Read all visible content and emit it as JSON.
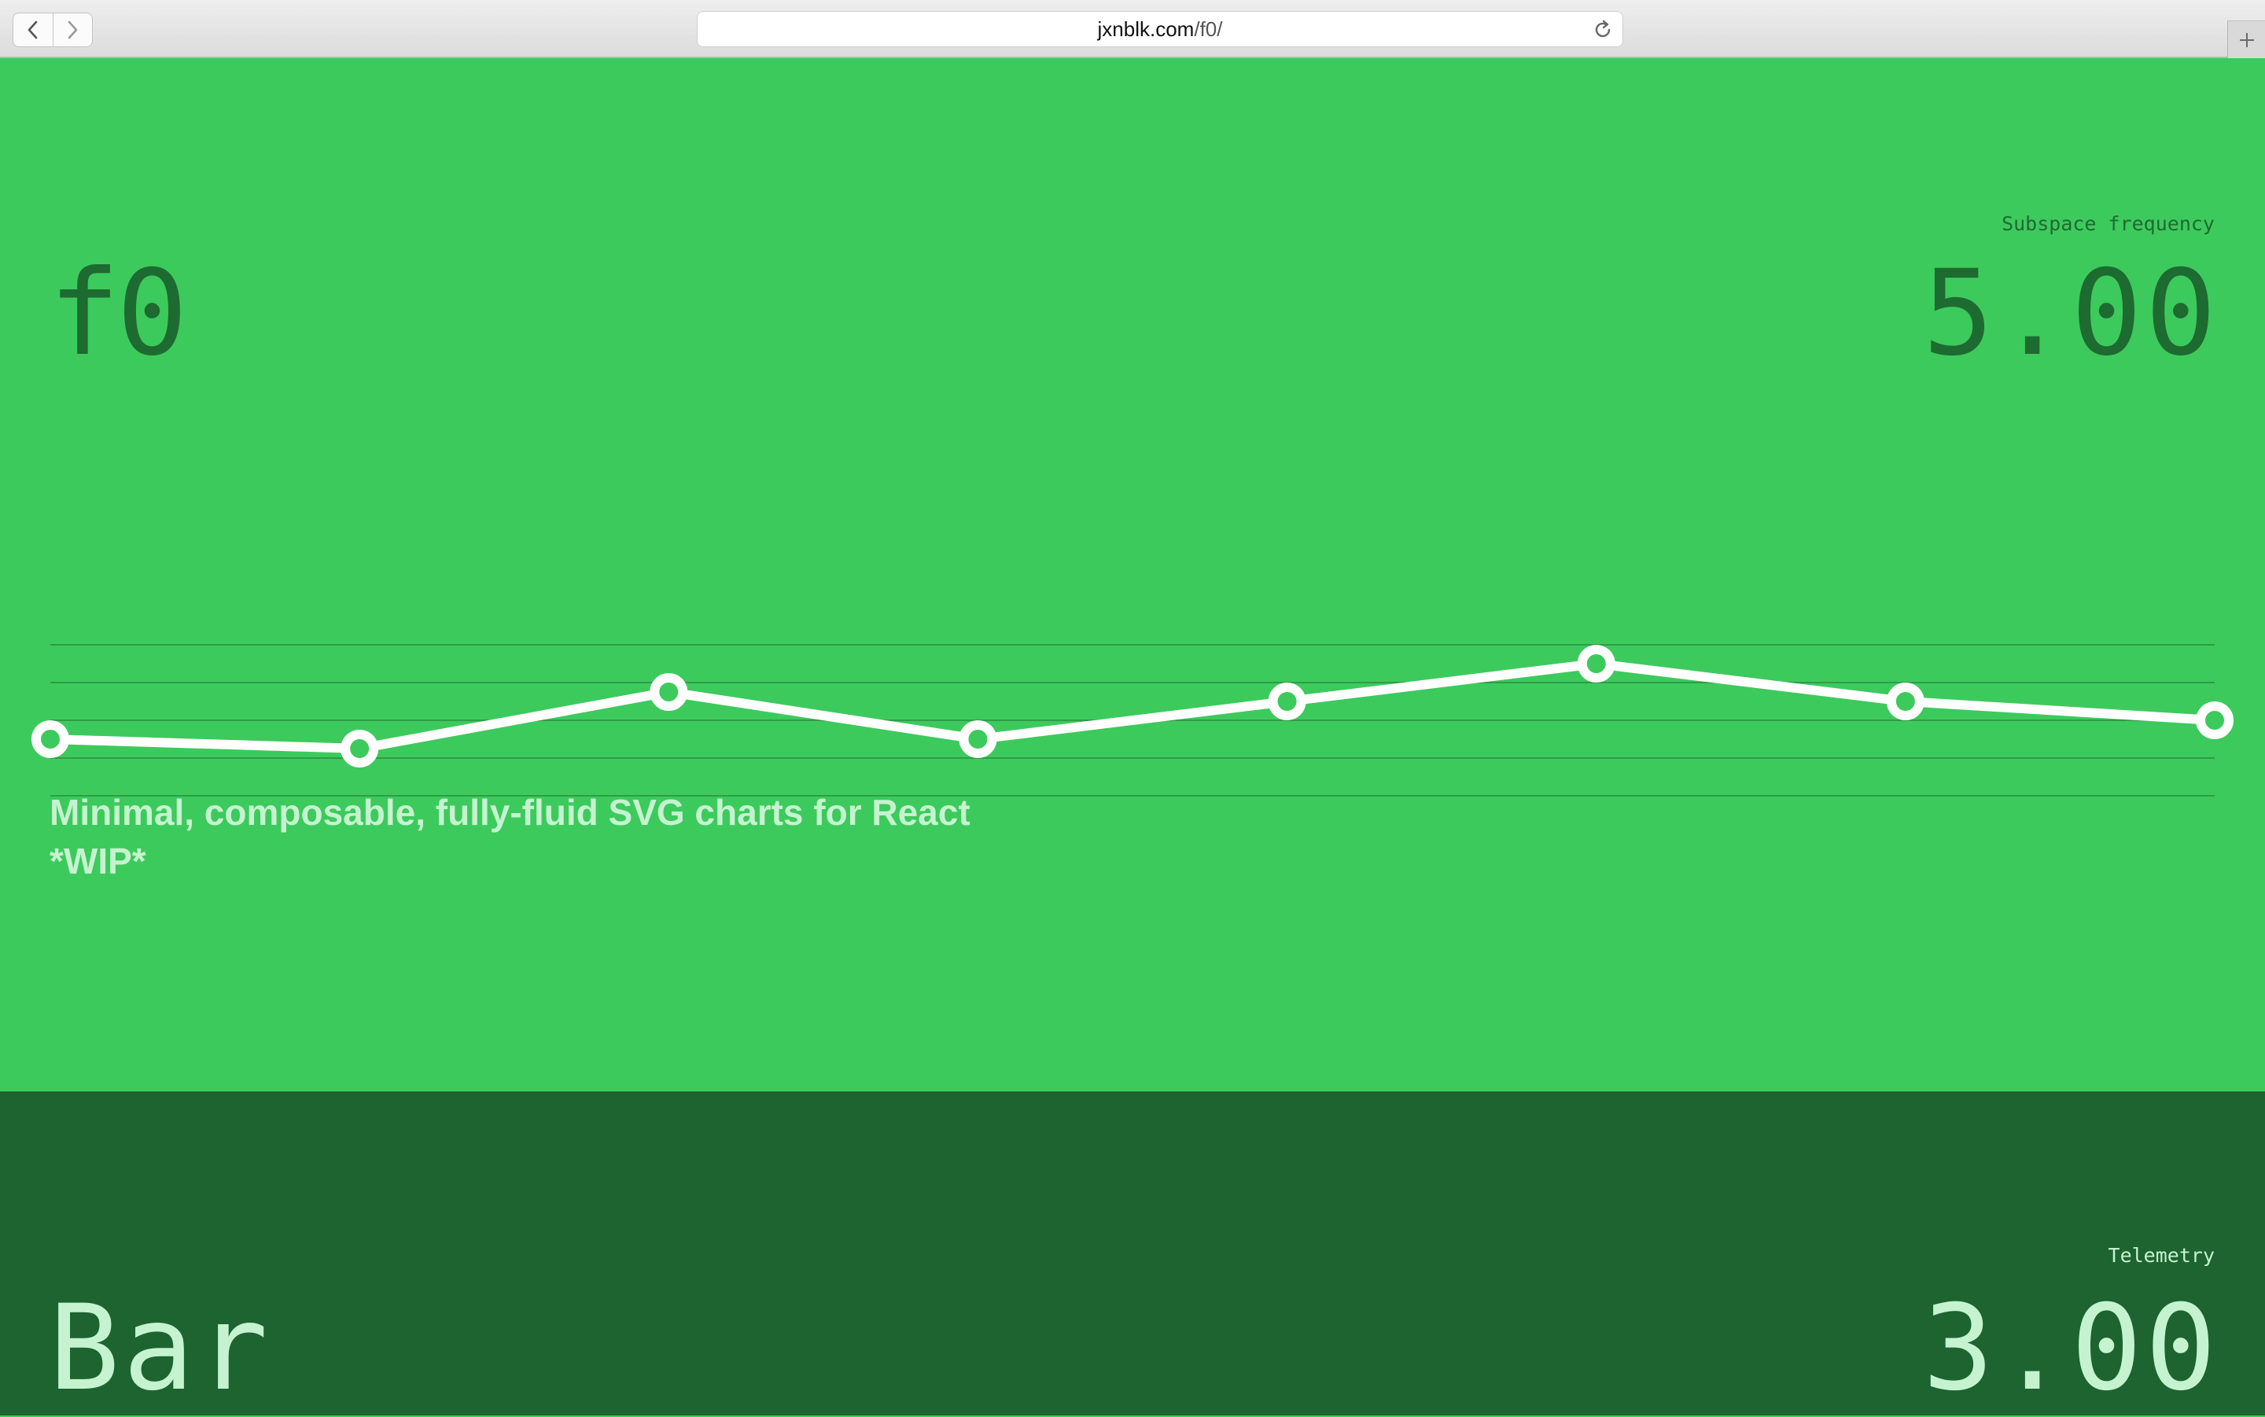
{
  "browser": {
    "url_host": "jxnblk.com",
    "url_path": "/f0/",
    "back_icon": "chevron-left-icon",
    "forward_icon": "chevron-right-icon",
    "reload_icon": "reload-icon",
    "new_tab_icon": "plus-icon"
  },
  "hero": {
    "title": "f0",
    "metric_label": "Subspace frequency",
    "metric_value": "5.00",
    "tagline_line1": "Minimal, composable, fully-fluid SVG charts for React",
    "tagline_line2": "*WIP*",
    "colors": {
      "background": "#3dca5c",
      "text": "#1d6b31",
      "line": "#ffffff",
      "tagline": "#c5f3d0"
    }
  },
  "section2": {
    "title": "Bar",
    "metric_label": "Telemetry",
    "metric_value": "3.00",
    "colors": {
      "background": "#1d6430",
      "text": "#c5f3d0"
    }
  },
  "chart_data": {
    "type": "line",
    "x": [
      0,
      1,
      2,
      3,
      4,
      5,
      6,
      7
    ],
    "values": [
      1.5,
      1.25,
      2.75,
      1.5,
      2.5,
      3.5,
      2.5,
      2.0
    ],
    "ylim": [
      0,
      8
    ],
    "grid": true,
    "gridlines": 5,
    "markers": "hollow-circle",
    "title": "",
    "xlabel": "",
    "ylabel": ""
  }
}
